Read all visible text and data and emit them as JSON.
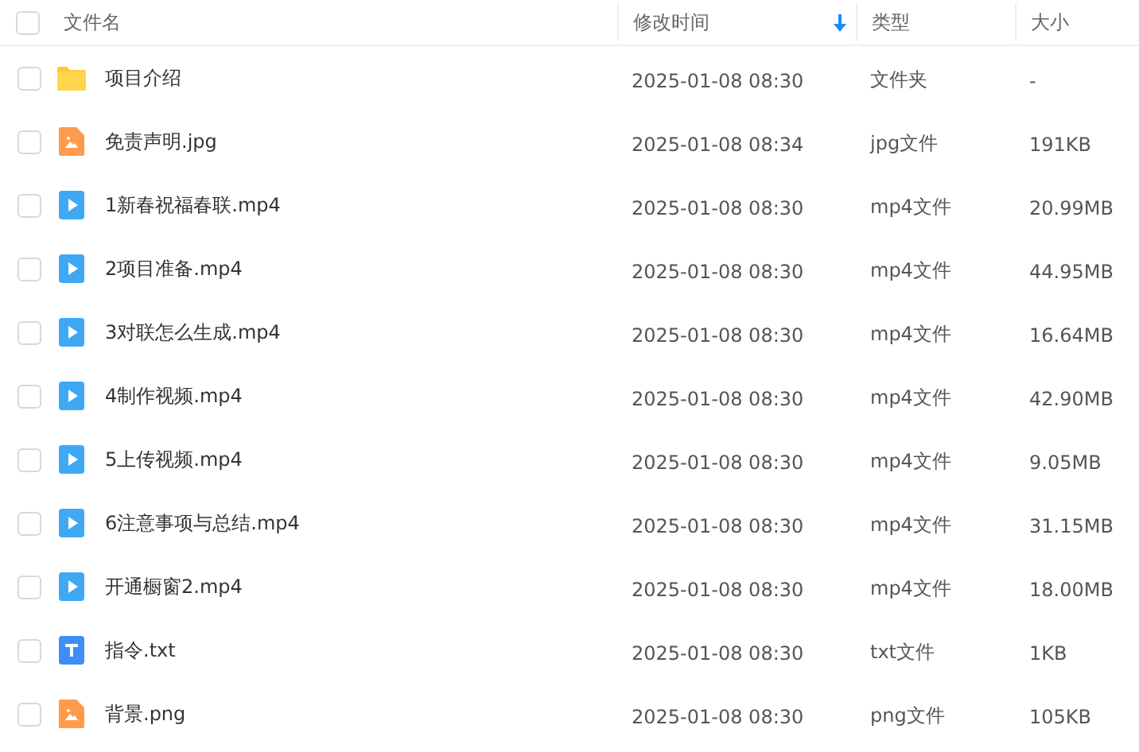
{
  "table": {
    "select_all": {
      "checked": false
    },
    "columns": [
      {
        "label": "文件名",
        "sorted": false
      },
      {
        "label": "修改时间",
        "sorted": true
      },
      {
        "label": "类型",
        "sorted": false
      },
      {
        "label": "大小",
        "sorted": false
      }
    ],
    "rows": [
      {
        "kind": "folder",
        "checked": false,
        "name": "项目介绍",
        "modified": "2025-01-08 08:30",
        "type": "文件夹",
        "size": "-"
      },
      {
        "kind": "image",
        "checked": false,
        "name": "免责声明.jpg",
        "modified": "2025-01-08 08:34",
        "type": "jpg文件",
        "size": "191KB"
      },
      {
        "kind": "video",
        "checked": false,
        "name": "1新春祝福春联.mp4",
        "modified": "2025-01-08 08:30",
        "type": "mp4文件",
        "size": "20.99MB"
      },
      {
        "kind": "video",
        "checked": false,
        "name": "2项目准备.mp4",
        "modified": "2025-01-08 08:30",
        "type": "mp4文件",
        "size": "44.95MB"
      },
      {
        "kind": "video",
        "checked": false,
        "name": "3对联怎么生成.mp4",
        "modified": "2025-01-08 08:30",
        "type": "mp4文件",
        "size": "16.64MB"
      },
      {
        "kind": "video",
        "checked": false,
        "name": "4制作视频.mp4",
        "modified": "2025-01-08 08:30",
        "type": "mp4文件",
        "size": "42.90MB"
      },
      {
        "kind": "video",
        "checked": false,
        "name": "5上传视频.mp4",
        "modified": "2025-01-08 08:30",
        "type": "mp4文件",
        "size": "9.05MB"
      },
      {
        "kind": "video",
        "checked": false,
        "name": "6注意事项与总结.mp4",
        "modified": "2025-01-08 08:30",
        "type": "mp4文件",
        "size": "31.15MB"
      },
      {
        "kind": "video",
        "checked": false,
        "name": "开通橱窗2.mp4",
        "modified": "2025-01-08 08:30",
        "type": "mp4文件",
        "size": "18.00MB"
      },
      {
        "kind": "text",
        "checked": false,
        "name": "指令.txt",
        "modified": "2025-01-08 08:30",
        "type": "txt文件",
        "size": "1KB"
      },
      {
        "kind": "image",
        "checked": false,
        "name": "背景.png",
        "modified": "2025-01-08 08:30",
        "type": "png文件",
        "size": "105KB"
      }
    ]
  }
}
